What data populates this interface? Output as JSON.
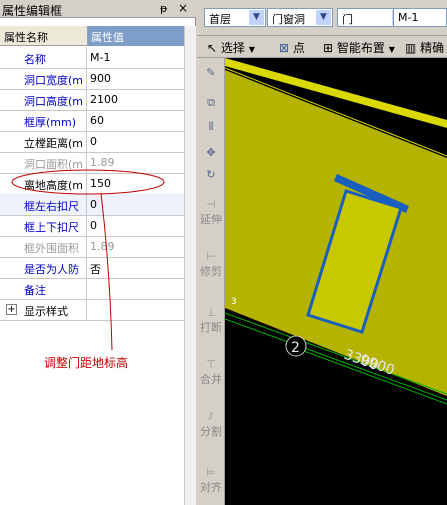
{
  "panel": {
    "title": "属性编辑框",
    "pin_icon": "ᵽ",
    "close_icon": "×",
    "header": {
      "name": "属性名称",
      "value": "属性值"
    },
    "rows": [
      {
        "name": "名称",
        "value": "M-1",
        "style": "blue"
      },
      {
        "name": "洞口宽度(m",
        "value": "900",
        "style": "blue"
      },
      {
        "name": "洞口高度(m",
        "value": "2100",
        "style": "blue"
      },
      {
        "name": "框厚(mm)",
        "value": "60",
        "style": "blue"
      },
      {
        "name": "立樘距离(m",
        "value": "0",
        "style": "blk"
      },
      {
        "name": "洞口面积(m",
        "value": "1.89",
        "style": "gray"
      },
      {
        "name": "离地高度(m",
        "value": "150",
        "style": "blk"
      },
      {
        "name": "框左右扣尺",
        "value": "0",
        "style": "blue"
      },
      {
        "name": "框上下扣尺",
        "value": "0",
        "style": "blue"
      },
      {
        "name": "框外围面积",
        "value": "1.89",
        "style": "gray"
      },
      {
        "name": "是否为人防",
        "value": "否",
        "style": "blue"
      },
      {
        "name": "备注",
        "value": "",
        "style": "blue"
      },
      {
        "name": "显示样式",
        "value": "",
        "style": "blk"
      }
    ],
    "expand_icon": "+"
  },
  "annotation": {
    "text": "调整门距地标高",
    "color": "#c00000"
  },
  "toolbar": {
    "floor": "首层",
    "category": "门窗洞",
    "type": "门",
    "component": "M-1",
    "select_label": "选择",
    "point_label": "点",
    "smart_layout_label": "智能布置",
    "precise_label": "精确"
  },
  "side_tools": [
    "延伸",
    "修剪",
    "打断",
    "合并",
    "分割",
    "对齐"
  ],
  "canvas": {
    "axis_number": "2",
    "dim_3300": "3300",
    "dim_9900": "9900",
    "tick_label": "3"
  },
  "colors": {
    "wall": "#b3b300",
    "door_fill": "#c8c800",
    "door_border": "#1a5fc0",
    "axis": "#00aa00"
  }
}
